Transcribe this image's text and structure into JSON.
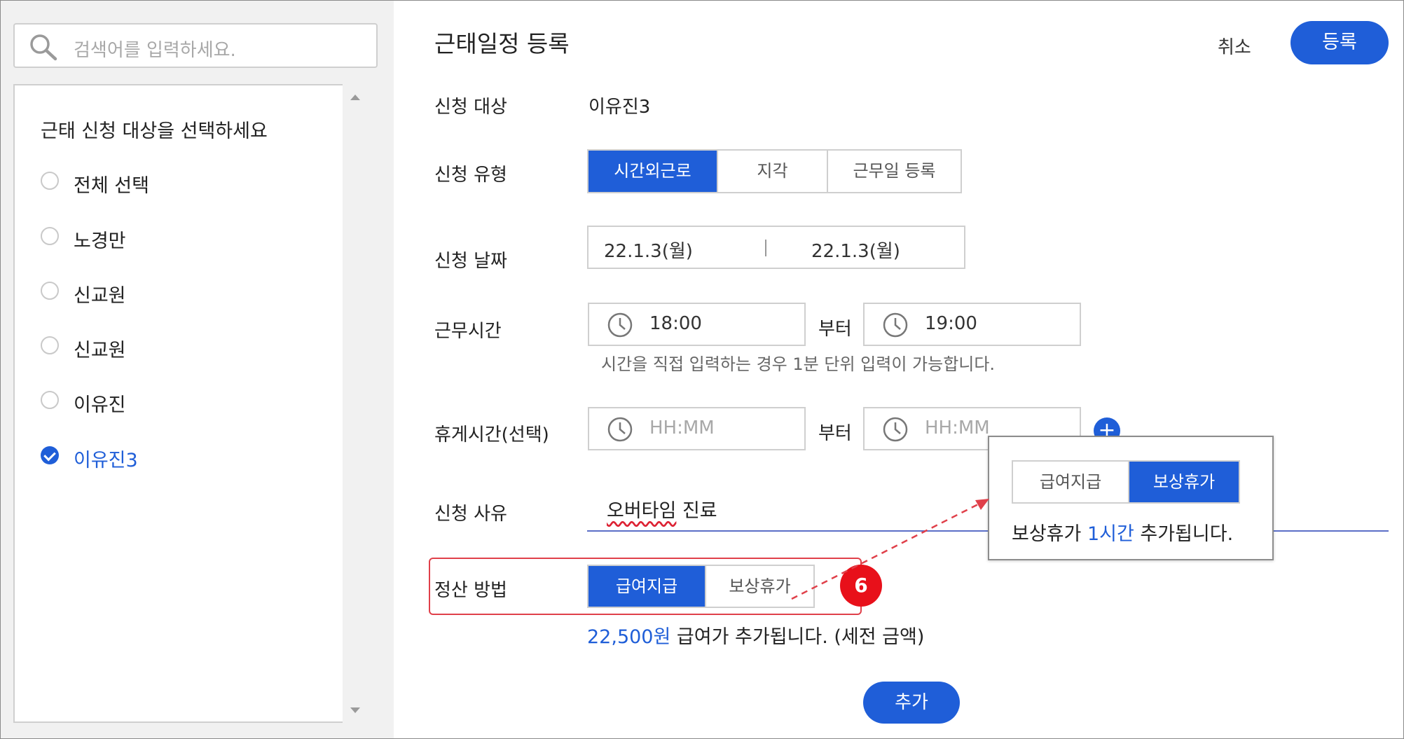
{
  "search": {
    "placeholder": "검색어를 입력하세요."
  },
  "target_list": {
    "title": "근태 신청 대상을 선택하세요",
    "items": [
      {
        "label": "전체 선택",
        "checked": false
      },
      {
        "label": "노경만",
        "checked": false
      },
      {
        "label": "신교원",
        "checked": false
      },
      {
        "label": "신교원",
        "checked": false
      },
      {
        "label": "이유진",
        "checked": false
      },
      {
        "label": "이유진3",
        "checked": true
      }
    ]
  },
  "form": {
    "title": "근태일정 등록",
    "cancel_label": "취소",
    "register_label": "등록",
    "target": {
      "label": "신청 대상",
      "value": "이유진3"
    },
    "type": {
      "label": "신청 유형",
      "options": [
        "시간외근로",
        "지각",
        "근무일 등록"
      ],
      "selected": "시간외근로"
    },
    "date": {
      "label": "신청 날짜",
      "start": "22.1.3(월)",
      "end": "22.1.3(월)"
    },
    "work_time": {
      "label": "근무시간",
      "start": "18:00",
      "from_label": "부터",
      "end": "19:00",
      "hint": "시간을 직접 입력하는 경우 1분 단위 입력이 가능합니다."
    },
    "break_time": {
      "label": "휴게시간(선택)",
      "start_placeholder": "HH:MM",
      "from_label": "부터",
      "end_placeholder": "HH:MM"
    },
    "reason": {
      "label": "신청 사유",
      "value_underlined": "오버타임",
      "value_rest": " 진료"
    },
    "settlement": {
      "label": "정산 방법",
      "options": [
        "급여지급",
        "보상휴가"
      ],
      "selected": "급여지급"
    },
    "settlement_note": {
      "amount": "22,500원",
      "text": " 급여가 추가됩니다. (세전 금액)"
    },
    "add_label": "추가"
  },
  "callout": {
    "badge": "6",
    "options": [
      "급여지급",
      "보상휴가"
    ],
    "selected": "보상휴가",
    "msg_prefix": "보상휴가 ",
    "msg_highlight": "1시간",
    "msg_suffix": " 추가됩니다."
  },
  "colors": {
    "accent": "#1f5ed8",
    "highlight_border": "#e0404a",
    "badge": "#e8101a"
  }
}
